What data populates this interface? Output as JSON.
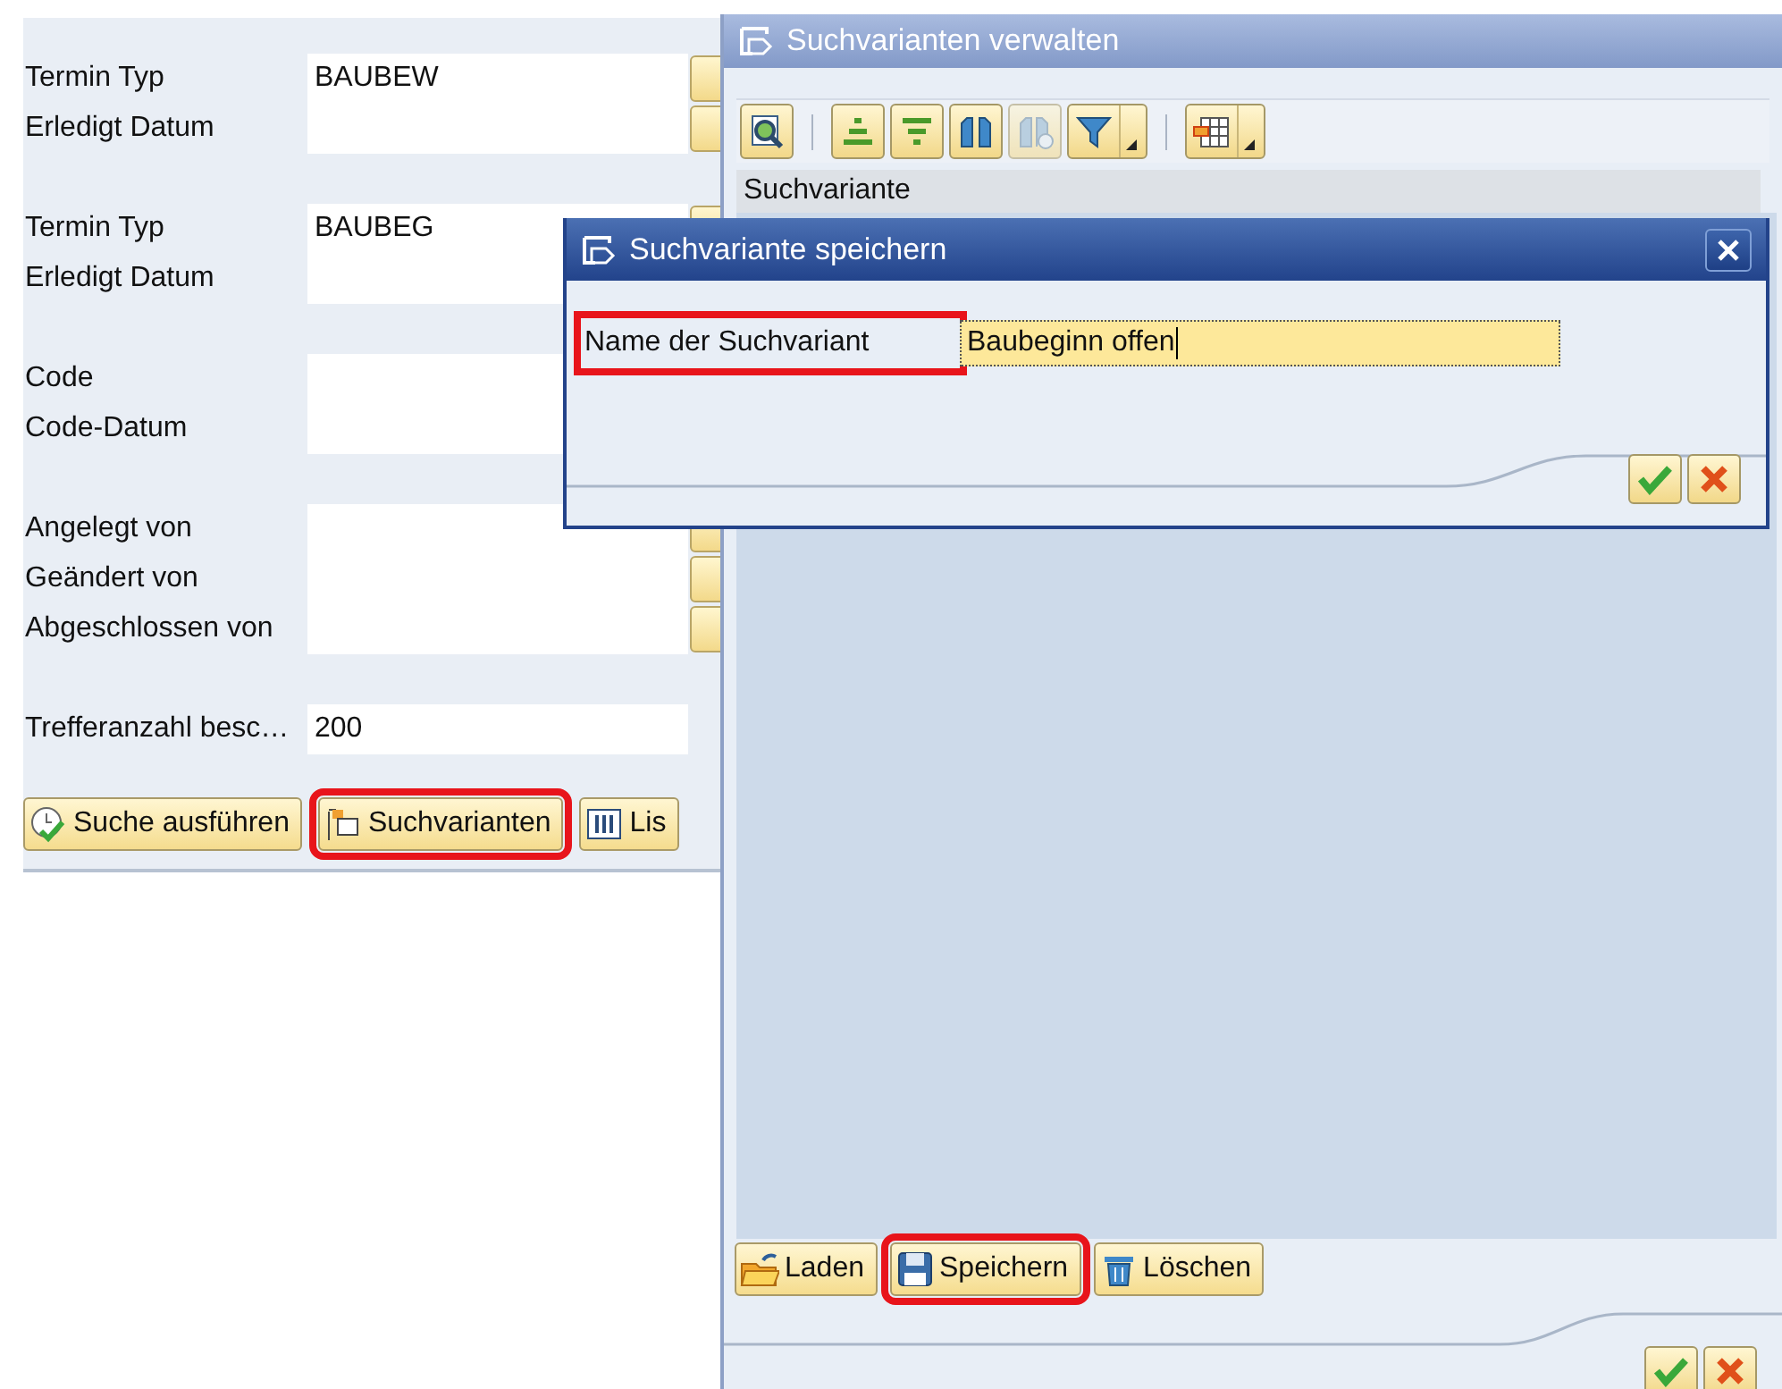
{
  "search_panel": {
    "groups": [
      {
        "rows": [
          {
            "label": "Termin Typ",
            "value": "BAUBEW",
            "more_button": true
          },
          {
            "label": "Erledigt Datum",
            "more_button": true
          }
        ]
      },
      {
        "rows": [
          {
            "label": "Termin Typ",
            "value": "BAUBEG",
            "more_button": true
          },
          {
            "label": "Erledigt Datum"
          }
        ]
      },
      {
        "rows": [
          {
            "label": "Code"
          },
          {
            "label": "Code-Datum"
          }
        ]
      },
      {
        "rows": [
          {
            "label": "Angelegt von",
            "more_button": true
          },
          {
            "label": "Geändert von",
            "more_button": true
          },
          {
            "label": "Abgeschlossen von",
            "more_button": true
          }
        ]
      }
    ],
    "hit_limit": {
      "label": "Trefferanzahl besc…",
      "value": "200"
    },
    "buttons": [
      {
        "label": "Suche ausführen",
        "highlighted": false
      },
      {
        "label": "Suchvarianten",
        "highlighted": true
      },
      {
        "label": "Lis",
        "highlighted": false
      }
    ]
  },
  "manage_dialog": {
    "title": "Suchvarianten verwalten",
    "toolbar": [
      [
        {
          "disabled": false,
          "menu": false
        }
      ],
      [
        {
          "disabled": false,
          "menu": false
        },
        {
          "disabled": false,
          "menu": false
        },
        {
          "disabled": false,
          "menu": false
        },
        {
          "disabled": true,
          "menu": false
        },
        {
          "disabled": false,
          "menu": true
        }
      ],
      [
        {
          "disabled": false,
          "menu": true
        }
      ]
    ],
    "column_header": "Suchvariante",
    "buttons": [
      {
        "label": "Laden",
        "highlighted": false
      },
      {
        "label": "Speichern",
        "highlighted": true
      },
      {
        "label": "Löschen",
        "highlighted": false
      }
    ]
  },
  "save_dialog": {
    "title": "Suchvariante speichern",
    "field": {
      "label": "Name der Suchvariant",
      "value": "Baubeginn offen",
      "highlighted": true
    }
  }
}
